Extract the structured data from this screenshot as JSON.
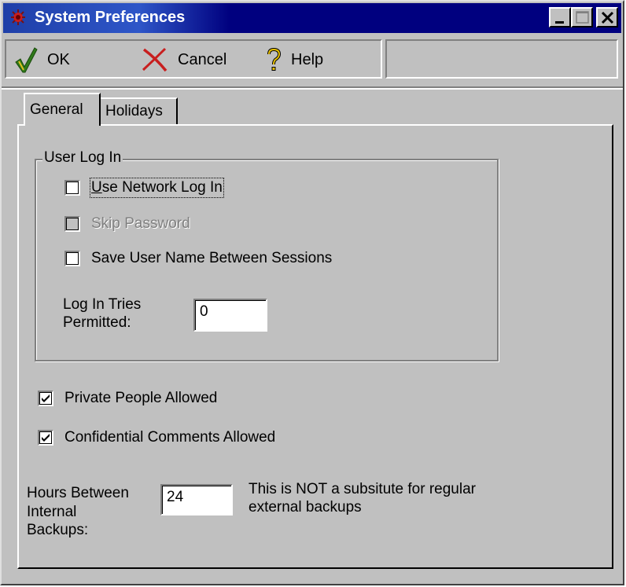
{
  "window": {
    "title": "System Preferences"
  },
  "toolbar": {
    "ok_label": "OK",
    "cancel_label": "Cancel",
    "help_label": "Help"
  },
  "tabs": [
    {
      "label": "General",
      "active": true
    },
    {
      "label": "Holidays",
      "active": false
    }
  ],
  "user_login": {
    "group_title": "User Log In",
    "use_network_login": {
      "label": "Use Network Log In",
      "checked": false,
      "enabled": true
    },
    "skip_password": {
      "label": "Skip Password",
      "checked": false,
      "enabled": false
    },
    "save_user_name": {
      "label": "Save User Name Between Sessions",
      "checked": false,
      "enabled": true
    },
    "login_tries_label_line1": "Log In Tries",
    "login_tries_label_line2": "Permitted:",
    "login_tries_value": "0"
  },
  "options": {
    "private_people": {
      "label": "Private People Allowed",
      "checked": true
    },
    "confidential_comments": {
      "label": "Confidential Comments Allowed",
      "checked": true
    }
  },
  "backups": {
    "label_line1": "Hours Between",
    "label_line2": "Internal",
    "label_line3": "Backups:",
    "value": "24",
    "note_line1": "This is NOT a subsitute for regular",
    "note_line2": "external backups"
  },
  "colors": {
    "titlebar": "#00007f",
    "face": "#c0c0c0",
    "ok_check": "#2f7a1a",
    "cancel_x": "#c81e1e",
    "help_icon": "#c8a400"
  }
}
